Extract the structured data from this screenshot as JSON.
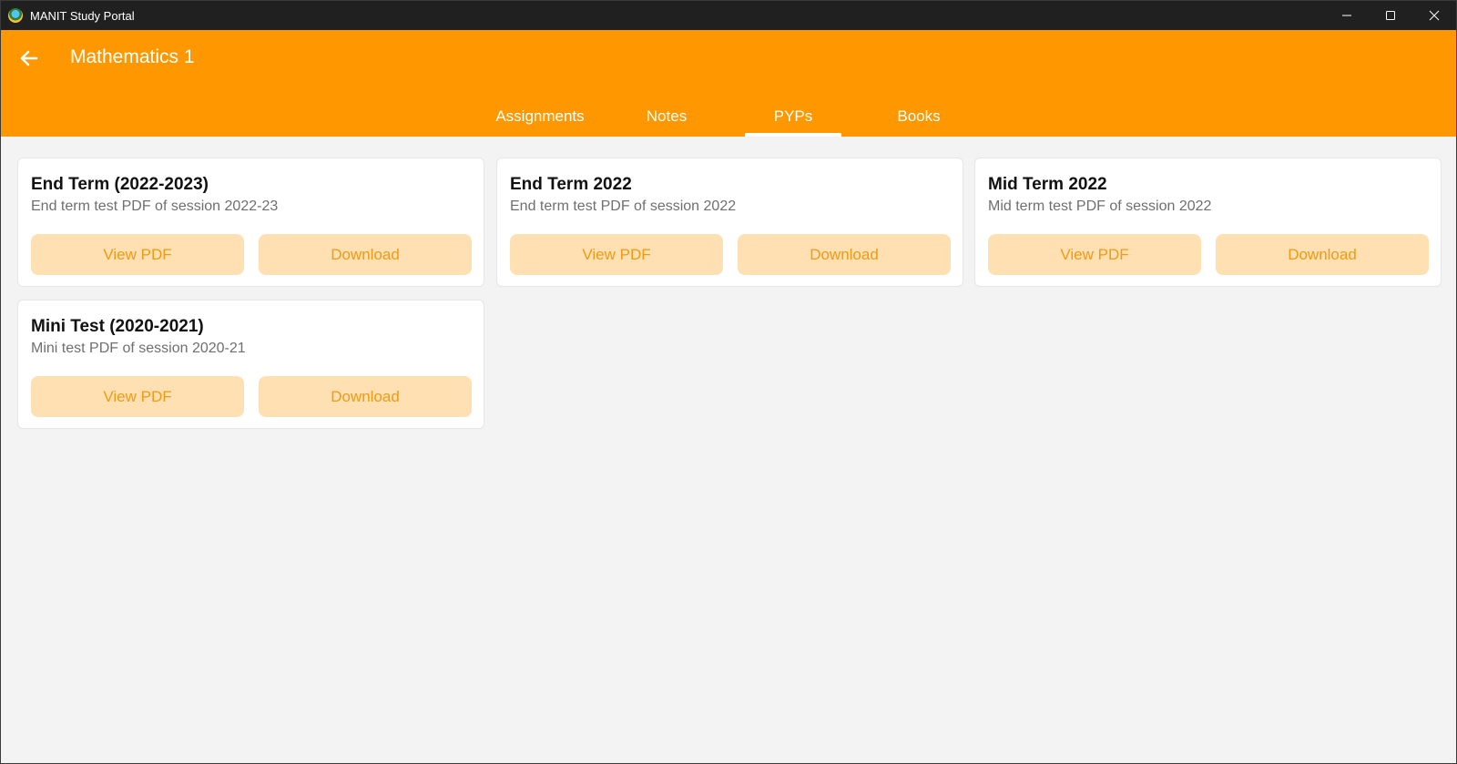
{
  "window": {
    "title": "MANIT Study Portal",
    "controls": {
      "minimize_icon": "minimize-icon",
      "maximize_icon": "maximize-icon",
      "close_icon": "close-icon"
    }
  },
  "header": {
    "back_icon": "arrow-left-icon",
    "title": "Mathematics 1",
    "color": "#ff9800"
  },
  "tabs": [
    {
      "label": "Assignments",
      "active": false
    },
    {
      "label": "Notes",
      "active": false
    },
    {
      "label": "PYPs",
      "active": true
    },
    {
      "label": "Books",
      "active": false
    }
  ],
  "cards": [
    {
      "title": "End Term (2022-2023)",
      "description": "End term test PDF of session 2022-23",
      "view_label": "View PDF",
      "download_label": "Download"
    },
    {
      "title": "End Term 2022",
      "description": "End term test PDF of session 2022",
      "view_label": "View PDF",
      "download_label": "Download"
    },
    {
      "title": "Mid Term 2022",
      "description": "Mid term test PDF of session 2022",
      "view_label": "View PDF",
      "download_label": "Download"
    },
    {
      "title": "Mini Test (2020-2021)",
      "description": "Mini test PDF of session 2020-21",
      "view_label": "View PDF",
      "download_label": "Download"
    }
  ],
  "colors": {
    "accent": "#ff9800",
    "button_bg": "#ffe0b2",
    "button_text": "#f19a12"
  }
}
